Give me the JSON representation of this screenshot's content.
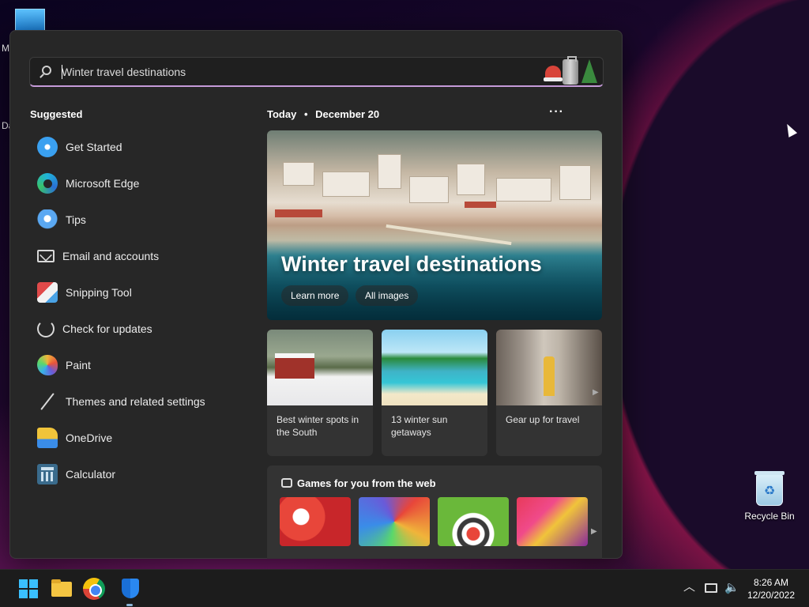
{
  "desktop": {
    "left_letters": [
      "M",
      "Da"
    ],
    "recycle_bin_label": "Recycle Bin"
  },
  "search": {
    "value": "Winter travel destinations",
    "placeholder": "Winter travel destinations"
  },
  "suggested": {
    "title": "Suggested",
    "items": [
      {
        "label": "Get Started",
        "icon": "get-started-icon"
      },
      {
        "label": "Microsoft Edge",
        "icon": "edge-icon"
      },
      {
        "label": "Tips",
        "icon": "tips-icon"
      },
      {
        "label": "Email and accounts",
        "icon": "mail-icon"
      },
      {
        "label": "Snipping Tool",
        "icon": "snipping-tool-icon"
      },
      {
        "label": "Check for updates",
        "icon": "update-icon"
      },
      {
        "label": "Paint",
        "icon": "paint-icon"
      },
      {
        "label": "Themes and related settings",
        "icon": "brush-icon"
      },
      {
        "label": "OneDrive",
        "icon": "onedrive-icon"
      },
      {
        "label": "Calculator",
        "icon": "calculator-icon"
      }
    ]
  },
  "today": {
    "label": "Today",
    "separator": "•",
    "date": "December 20",
    "more": "···"
  },
  "hero": {
    "title": "Winter travel destinations",
    "learn_more": "Learn more",
    "all_images": "All images"
  },
  "cards": [
    {
      "caption": "Best winter spots in the South"
    },
    {
      "caption": "13 winter sun getaways"
    },
    {
      "caption": "Gear up for travel"
    }
  ],
  "games": {
    "title": "Games for you from the web"
  },
  "taskbar": {
    "time": "8:26 AM",
    "date": "12/20/2022"
  },
  "colors": {
    "accent": "#c59ad9",
    "menu_bg": "#272727",
    "taskbar_bg": "#1c1c1c"
  }
}
